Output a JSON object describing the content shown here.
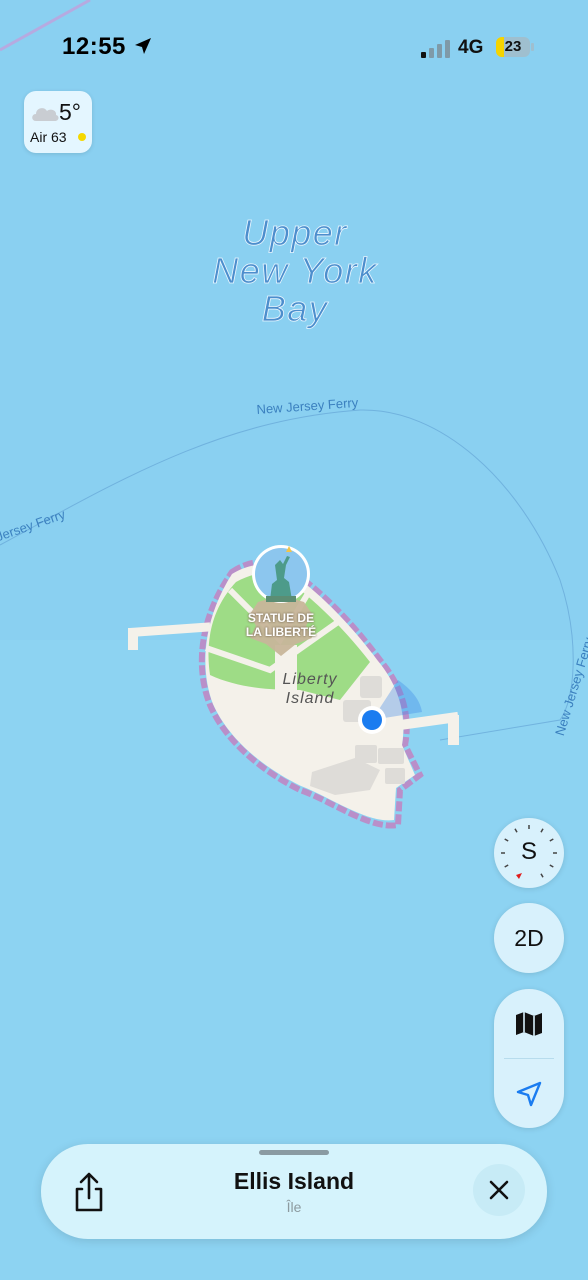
{
  "status_bar": {
    "time": "12:55",
    "network": "4G",
    "battery": "23",
    "battery_color": "#f5d400"
  },
  "weather": {
    "temperature": "5°",
    "air_quality": "Air 63",
    "icon": "cloud-icon"
  },
  "map": {
    "water_label": "Upper New York Bay",
    "water_label_lines": [
      "Upper",
      "New York",
      "Bay"
    ],
    "ferry_labels": [
      "New Jersey Ferry",
      "Jersey Ferry",
      "New Jersey Ferry"
    ],
    "island_label_lines": [
      "Liberty",
      "Island"
    ],
    "poi_label_lines": [
      "STATUE DE",
      "LA LIBERTÉ"
    ],
    "colors": {
      "water": "#8dd3f2",
      "park": "#9edc86",
      "island": "#f4f1ea",
      "boundary": "#b08fc4",
      "user_location": "#1a7cf0"
    }
  },
  "controls": {
    "compass_heading": "S",
    "view_mode": "2D",
    "map_mode_icon": "map-icon",
    "locate_icon": "location-arrow-icon"
  },
  "place_card": {
    "title": "Ellis Island",
    "subtitle": "Île"
  }
}
